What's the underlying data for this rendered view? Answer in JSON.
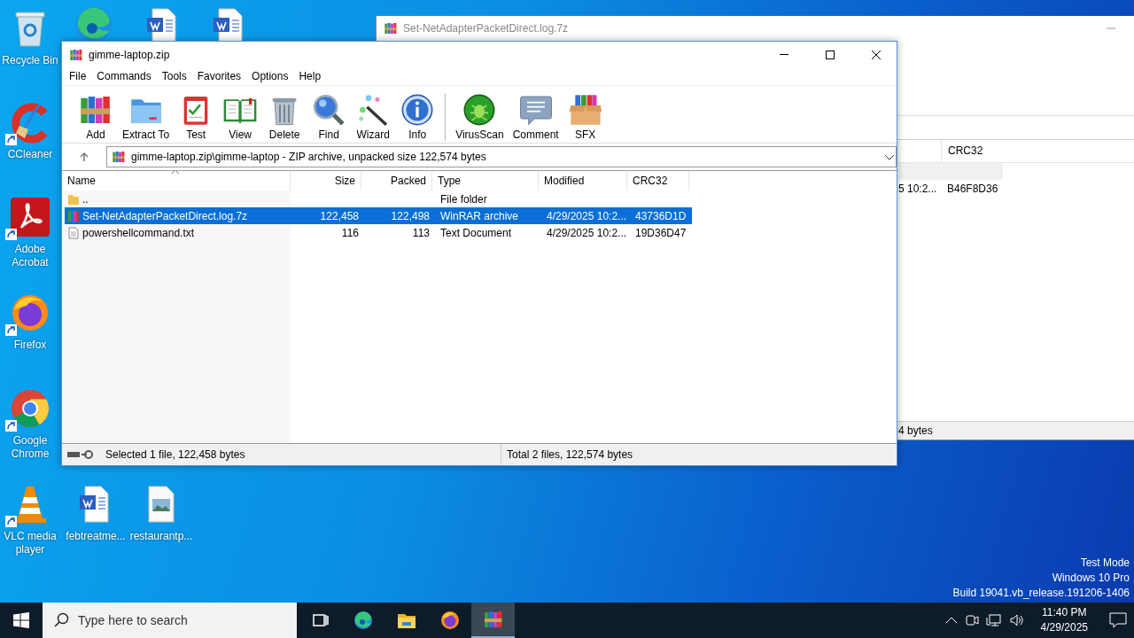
{
  "desktop": {
    "icons": [
      {
        "kind": "recycle-bin",
        "label": "Recycle Bin"
      },
      {
        "kind": "edge"
      },
      {
        "kind": "word-doc"
      },
      {
        "kind": "word-doc"
      },
      {
        "kind": "ccleaner",
        "label": "CCleaner",
        "shortcut": true
      },
      {
        "kind": "acrobat",
        "label": "Adobe Acrobat",
        "shortcut": true
      },
      {
        "kind": "firefox",
        "label": "Firefox",
        "shortcut": true
      },
      {
        "kind": "chrome",
        "label": "Google Chrome",
        "shortcut": true
      },
      {
        "kind": "vlc",
        "label": "VLC media player",
        "shortcut": true
      },
      {
        "kind": "word-doc",
        "label": "febtreatme..."
      },
      {
        "kind": "image-file",
        "label": "restaurantp..."
      }
    ],
    "os_notice": [
      "Test Mode",
      "Windows 10 Pro",
      "Build 19041.vb_release.191206-1406"
    ]
  },
  "background_window": {
    "title": "Set-NetAdapterPacketDirect.log.7z",
    "column": "CRC32",
    "row": [
      "5 10:2...",
      "B46F8D36"
    ],
    "status": "4 bytes"
  },
  "archive_window": {
    "title": "gimme-laptop.zip",
    "menu": [
      "File",
      "Commands",
      "Tools",
      "Favorites",
      "Options",
      "Help"
    ],
    "toolbar": [
      [
        {
          "kind": "add",
          "label": "Add"
        },
        {
          "kind": "extract",
          "label": "Extract To"
        },
        {
          "kind": "test",
          "label": "Test"
        },
        {
          "kind": "view",
          "label": "View"
        },
        {
          "kind": "delete",
          "label": "Delete"
        },
        {
          "kind": "find",
          "label": "Find"
        },
        {
          "kind": "wizard",
          "label": "Wizard"
        },
        {
          "kind": "info",
          "label": "Info"
        }
      ],
      [
        {
          "kind": "virusscan",
          "label": "VirusScan"
        },
        {
          "kind": "comment",
          "label": "Comment"
        },
        {
          "kind": "sfx",
          "label": "SFX"
        }
      ]
    ],
    "address": "gimme-laptop.zip\\gimme-laptop - ZIP archive, unpacked size 122,574 bytes",
    "columns": [
      {
        "label": "Name",
        "sorted": true
      },
      {
        "label": "Size",
        "sorted": false
      },
      {
        "label": "Packed",
        "sorted": false
      },
      {
        "label": "Type",
        "sorted": false
      },
      {
        "label": "Modified",
        "sorted": false
      },
      {
        "label": "CRC32",
        "sorted": false
      }
    ],
    "rows": [
      {
        "kind": "folder",
        "selected": false,
        "name": "..",
        "type": "File folder"
      },
      {
        "kind": "archive",
        "selected": true,
        "name": "Set-NetAdapterPacketDirect.log.7z",
        "size": "122,458",
        "packed": "122,498",
        "type": "WinRAR archive",
        "modified": "4/29/2025 10:2...",
        "crc": "43736D1D"
      },
      {
        "kind": "text",
        "selected": false,
        "name": "powershellcommand.txt",
        "size": "116",
        "packed": "113",
        "type": "Text Document",
        "modified": "4/29/2025 10:2...",
        "crc": "19D36D47"
      }
    ],
    "status_left": "Selected 1 file, 122,458 bytes",
    "status_right": "Total 2 files, 122,574 bytes"
  },
  "taskbar": {
    "search_placeholder": "Type here to search",
    "apps": [
      {
        "kind": "task-view",
        "active": false
      },
      {
        "kind": "edge",
        "active": false
      },
      {
        "kind": "explorer",
        "active": false
      },
      {
        "kind": "firefox",
        "active": false
      },
      {
        "kind": "winrar",
        "active": true
      }
    ],
    "time": "11:40 PM",
    "date": "4/29/2025"
  }
}
